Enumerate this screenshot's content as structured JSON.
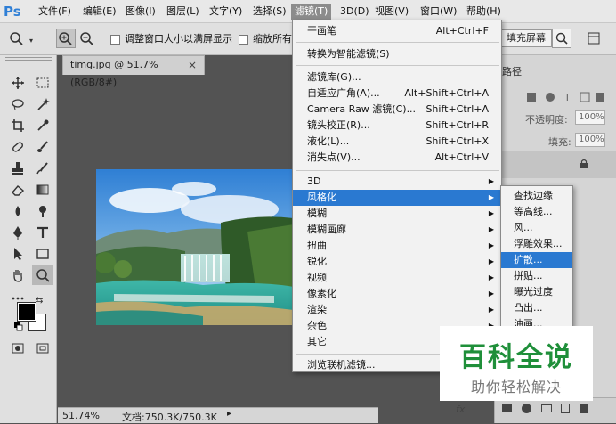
{
  "app": {
    "logo": "Ps"
  },
  "menubar": {
    "items": [
      "文件(F)",
      "编辑(E)",
      "图像(I)",
      "图层(L)",
      "文字(Y)",
      "选择(S)",
      "滤镜(T)",
      "3D(D)",
      "视图(V)",
      "窗口(W)",
      "帮助(H)"
    ],
    "active_index": 6
  },
  "options_bar": {
    "resize_windows_label": "调整窗口大小以满屏显示",
    "zoom_all_label": "缩放所有",
    "fill_screen_button": "填充屏幕"
  },
  "document": {
    "tab_title": "timg.jpg @ 51.7%(RGB/8#)",
    "close_glyph": "×",
    "zoom": "51.74%",
    "doc_size": "文档:750.3K/750.3K"
  },
  "right_panel": {
    "tab_label": "路径",
    "opacity_label": "不透明度:",
    "opacity_value": "100%",
    "fill_label": "填充:",
    "fill_value": "100%"
  },
  "filter_menu": {
    "items": [
      {
        "label": "干画笔",
        "shortcut": "Alt+Ctrl+F"
      },
      {
        "label": "转换为智能滤镜(S)",
        "shortcut": ""
      },
      {
        "label": "滤镜库(G)...",
        "shortcut": ""
      },
      {
        "label": "自适应广角(A)...",
        "shortcut": "Alt+Shift+Ctrl+A"
      },
      {
        "label": "Camera Raw 滤镜(C)...",
        "shortcut": "Shift+Ctrl+A"
      },
      {
        "label": "镜头校正(R)...",
        "shortcut": "Shift+Ctrl+R"
      },
      {
        "label": "液化(L)...",
        "shortcut": "Shift+Ctrl+X"
      },
      {
        "label": "消失点(V)...",
        "shortcut": "Alt+Ctrl+V"
      },
      {
        "label": "3D",
        "shortcut": ""
      },
      {
        "label": "风格化",
        "shortcut": ""
      },
      {
        "label": "模糊",
        "shortcut": ""
      },
      {
        "label": "模糊画廊",
        "shortcut": ""
      },
      {
        "label": "扭曲",
        "shortcut": ""
      },
      {
        "label": "锐化",
        "shortcut": ""
      },
      {
        "label": "视频",
        "shortcut": ""
      },
      {
        "label": "像素化",
        "shortcut": ""
      },
      {
        "label": "渲染",
        "shortcut": ""
      },
      {
        "label": "杂色",
        "shortcut": ""
      },
      {
        "label": "其它",
        "shortcut": ""
      },
      {
        "label": "浏览联机滤镜...",
        "shortcut": ""
      }
    ]
  },
  "stylize_submenu": {
    "items": [
      "查找边缘",
      "等高线...",
      "风...",
      "浮雕效果...",
      "扩散...",
      "拼贴...",
      "曝光过度",
      "凸出...",
      "油画..."
    ]
  },
  "watermark": {
    "title": "百科全说",
    "subtitle": "助你轻松解决"
  },
  "colors": {
    "highlight": "#2a79d1",
    "watermark_green": "#1f8f3a",
    "logo_blue": "#2f7fd6"
  }
}
